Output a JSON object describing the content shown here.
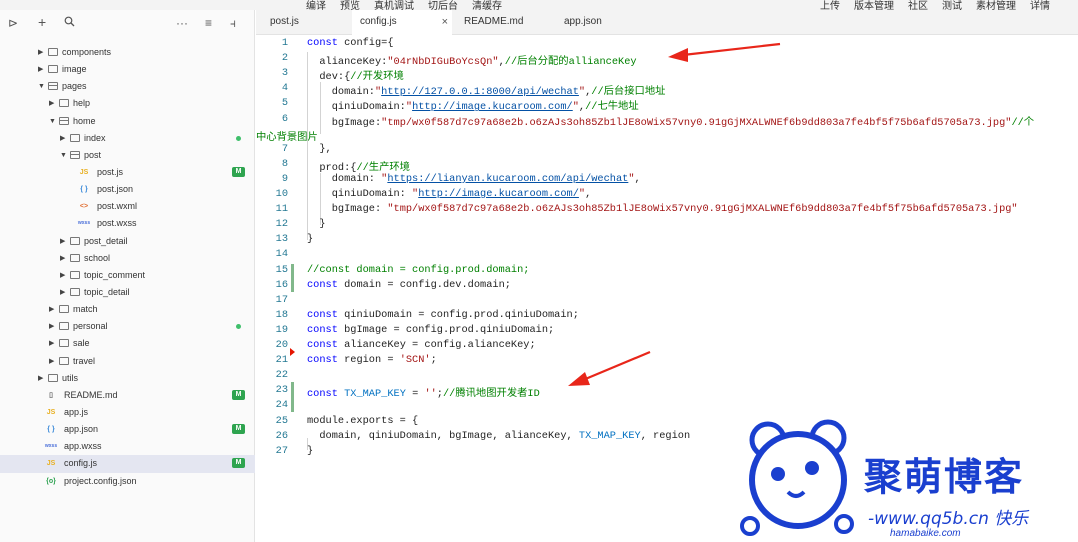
{
  "toolbar": {
    "left_items": [
      "编译",
      "预览",
      "真机调试",
      "切后台",
      "清缓存"
    ],
    "right_items": [
      "上传",
      "版本管理",
      "社区",
      "测试",
      "素材管理",
      "详情"
    ]
  },
  "explorer": {
    "icons": [
      "panel-toggle-icon",
      "plus-icon",
      "search-icon",
      "more-icon",
      "collapse-icon",
      "split-icon"
    ],
    "tree": [
      {
        "label": "components",
        "kind": "folder",
        "depth": 0,
        "expanded": false
      },
      {
        "label": "image",
        "kind": "folder",
        "depth": 0,
        "expanded": false
      },
      {
        "label": "pages",
        "kind": "folder",
        "depth": 0,
        "expanded": true
      },
      {
        "label": "help",
        "kind": "folder",
        "depth": 1,
        "expanded": false
      },
      {
        "label": "home",
        "kind": "folder",
        "depth": 1,
        "expanded": true
      },
      {
        "label": "index",
        "kind": "folder",
        "depth": 2,
        "expanded": false,
        "status": "dot"
      },
      {
        "label": "post",
        "kind": "folder",
        "depth": 2,
        "expanded": true
      },
      {
        "label": "post.js",
        "kind": "js",
        "depth": 3,
        "status": "M"
      },
      {
        "label": "post.json",
        "kind": "json",
        "depth": 3
      },
      {
        "label": "post.wxml",
        "kind": "wxml",
        "depth": 3
      },
      {
        "label": "post.wxss",
        "kind": "wxss",
        "depth": 3
      },
      {
        "label": "post_detail",
        "kind": "folder",
        "depth": 2,
        "expanded": false
      },
      {
        "label": "school",
        "kind": "folder",
        "depth": 2,
        "expanded": false
      },
      {
        "label": "topic_comment",
        "kind": "folder",
        "depth": 2,
        "expanded": false
      },
      {
        "label": "topic_detail",
        "kind": "folder",
        "depth": 2,
        "expanded": false
      },
      {
        "label": "match",
        "kind": "folder",
        "depth": 1,
        "expanded": false
      },
      {
        "label": "personal",
        "kind": "folder",
        "depth": 1,
        "expanded": false,
        "status": "dot"
      },
      {
        "label": "sale",
        "kind": "folder",
        "depth": 1,
        "expanded": false
      },
      {
        "label": "travel",
        "kind": "folder",
        "depth": 1,
        "expanded": false
      },
      {
        "label": "utils",
        "kind": "folder",
        "depth": 0,
        "expanded": false
      },
      {
        "label": "README.md",
        "kind": "md",
        "depth": 0,
        "status": "M"
      },
      {
        "label": "app.js",
        "kind": "js",
        "depth": 0
      },
      {
        "label": "app.json",
        "kind": "json",
        "depth": 0,
        "status": "M"
      },
      {
        "label": "app.wxss",
        "kind": "wxss",
        "depth": 0
      },
      {
        "label": "config.js",
        "kind": "js",
        "depth": 0,
        "status": "M",
        "selected": true
      },
      {
        "label": "project.config.json",
        "kind": "cfg",
        "depth": 0
      }
    ]
  },
  "tabs": [
    {
      "label": "post.js",
      "active": false
    },
    {
      "label": "config.js",
      "active": true,
      "closable": true
    },
    {
      "label": "README.md",
      "active": false
    },
    {
      "label": "app.json",
      "active": false
    }
  ],
  "editor": {
    "lines": [
      {
        "n": "1",
        "parts": [
          [
            "k",
            "const"
          ],
          [
            "t",
            " config={"
          ]
        ]
      },
      {
        "n": "2",
        "parts": [
          [
            "t",
            "  alianceKey:"
          ],
          [
            "s",
            "\"04rNbDIGuBoYcsQn\""
          ],
          [
            "t",
            ","
          ],
          [
            "c",
            "//后台分配的allianceKey"
          ]
        ]
      },
      {
        "n": "3",
        "parts": [
          [
            "t",
            "  dev:{"
          ],
          [
            "c",
            "//开发环境"
          ]
        ]
      },
      {
        "n": "4",
        "parts": [
          [
            "t",
            "    domain:"
          ],
          [
            "s",
            "\""
          ],
          [
            "u",
            "http://127.0.0.1:8000/api/wechat"
          ],
          [
            "s",
            "\""
          ],
          [
            "t",
            ","
          ],
          [
            "c",
            "//后台接口地址"
          ]
        ]
      },
      {
        "n": "5",
        "parts": [
          [
            "t",
            "    qiniuDomain:"
          ],
          [
            "s",
            "\""
          ],
          [
            "u",
            "http://image.kucaroom.com/"
          ],
          [
            "s",
            "\""
          ],
          [
            "t",
            ","
          ],
          [
            "c",
            "//七牛地址"
          ]
        ]
      },
      {
        "n": "6",
        "parts": [
          [
            "t",
            "    bgImage:"
          ],
          [
            "s",
            "\"tmp/wx0f587d7c97a68e2b.o6zAJs3oh85Zb1lJE8oWix57vny0.91gGjMXALWNEf6b9dd803a7fe4bf5f75b6afd5705a73.jpg\""
          ],
          [
            "c",
            "//个"
          ]
        ]
      },
      {
        "n": "",
        "parts": [
          [
            "c",
            "中心背景图片"
          ]
        ]
      },
      {
        "n": "7",
        "parts": [
          [
            "t",
            "  },"
          ]
        ]
      },
      {
        "n": "8",
        "parts": [
          [
            "t",
            "  prod:{"
          ],
          [
            "c",
            "//生产环境"
          ]
        ]
      },
      {
        "n": "9",
        "parts": [
          [
            "t",
            "    domain: "
          ],
          [
            "s",
            "\""
          ],
          [
            "u",
            "https://lianyan.kucaroom.com/api/wechat"
          ],
          [
            "s",
            "\""
          ],
          [
            "t",
            ","
          ]
        ]
      },
      {
        "n": "10",
        "parts": [
          [
            "t",
            "    qiniuDomain: "
          ],
          [
            "s",
            "\""
          ],
          [
            "u",
            "http://image.kucaroom.com/"
          ],
          [
            "s",
            "\""
          ],
          [
            "t",
            ","
          ]
        ]
      },
      {
        "n": "11",
        "parts": [
          [
            "t",
            "    bgImage: "
          ],
          [
            "s",
            "\"tmp/wx0f587d7c97a68e2b.o6zAJs3oh85Zb1lJE8oWix57vny0.91gGjMXALWNEf6b9dd803a7fe4bf5f75b6afd5705a73.jpg\""
          ]
        ]
      },
      {
        "n": "12",
        "parts": [
          [
            "t",
            "  }"
          ]
        ]
      },
      {
        "n": "13",
        "parts": [
          [
            "t",
            "}"
          ]
        ]
      },
      {
        "n": "14",
        "parts": [
          [
            "t",
            ""
          ]
        ]
      },
      {
        "n": "15",
        "parts": [
          [
            "c",
            "//const domain = config.prod.domain;"
          ]
        ]
      },
      {
        "n": "16",
        "parts": [
          [
            "k",
            "const"
          ],
          [
            "t",
            " domain = config.dev.domain;"
          ]
        ]
      },
      {
        "n": "17",
        "parts": [
          [
            "t",
            ""
          ]
        ]
      },
      {
        "n": "18",
        "parts": [
          [
            "k",
            "const"
          ],
          [
            "t",
            " qiniuDomain = config.prod.qiniuDomain;"
          ]
        ]
      },
      {
        "n": "19",
        "parts": [
          [
            "k",
            "const"
          ],
          [
            "t",
            " bgImage = config.prod.qiniuDomain;"
          ]
        ]
      },
      {
        "n": "20",
        "parts": [
          [
            "k",
            "const"
          ],
          [
            "t",
            " alianceKey = config.alianceKey;"
          ]
        ]
      },
      {
        "n": "21",
        "parts": [
          [
            "k",
            "const"
          ],
          [
            "t",
            " region = "
          ],
          [
            "s",
            "'SCN'"
          ],
          [
            "t",
            ";"
          ]
        ]
      },
      {
        "n": "22",
        "parts": [
          [
            "t",
            ""
          ]
        ]
      },
      {
        "n": "23",
        "parts": [
          [
            "k",
            "const"
          ],
          [
            "t",
            " "
          ],
          [
            "cn",
            "TX_MAP_KEY"
          ],
          [
            "t",
            " = "
          ],
          [
            "s",
            "''"
          ],
          [
            "t",
            ";"
          ],
          [
            "c",
            "//腾讯地图开发者ID"
          ]
        ]
      },
      {
        "n": "24",
        "parts": [
          [
            "t",
            ""
          ]
        ]
      },
      {
        "n": "25",
        "parts": [
          [
            "t",
            "module.exports = {"
          ]
        ]
      },
      {
        "n": "26",
        "parts": [
          [
            "t",
            "  domain, qiniuDomain, bgImage, alianceKey, "
          ],
          [
            "cn",
            "TX_MAP_KEY"
          ],
          [
            "t",
            ", region"
          ]
        ]
      },
      {
        "n": "27",
        "parts": [
          [
            "t",
            "}"
          ]
        ]
      }
    ]
  },
  "colors": {
    "annotation_arrow": "#e8261a",
    "logo_blue": "#1a3fcf",
    "modified_badge": "#2ea44f",
    "line_number": "#237893"
  },
  "watermark": {
    "title": "聚萌博客",
    "subtitle": "-www.qq5b.cn 快乐",
    "url_strip": "hamabaike.com"
  }
}
